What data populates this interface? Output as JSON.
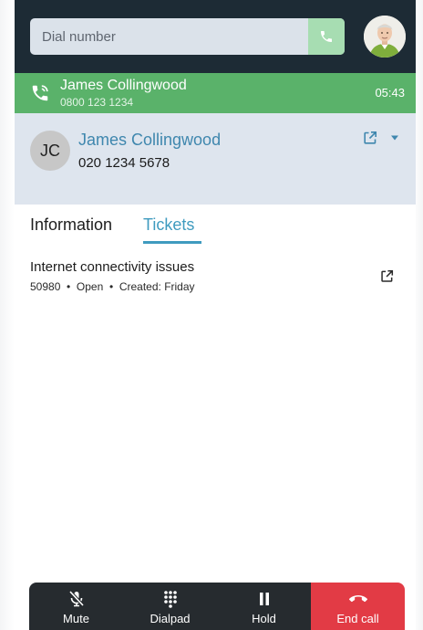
{
  "dial": {
    "placeholder": "Dial number",
    "call_icon": "phone-icon"
  },
  "active_call": {
    "name": "James Collingwood",
    "number": "0800 123 1234",
    "duration": "05:43",
    "icon": "phone-in-talk-icon"
  },
  "contact": {
    "initials": "JC",
    "name": "James Collingwood",
    "number": "020 1234 5678"
  },
  "tabs": [
    {
      "label": "Information",
      "active": false
    },
    {
      "label": "Tickets",
      "active": true
    }
  ],
  "tickets": [
    {
      "title": "Internet connectivity issues",
      "id": "50980",
      "status": "Open",
      "created": "Created: Friday",
      "separator": "•"
    }
  ],
  "actions": {
    "mute": "Mute",
    "dialpad": "Dialpad",
    "hold": "Hold",
    "end_call": "End call"
  },
  "colors": {
    "header": "#1d2b35",
    "call_green": "#5ab26a",
    "contact_bg": "#dee5ee",
    "link_blue": "#3f87ae",
    "tab_blue": "#3f9bbf",
    "end_red": "#e23b45",
    "action_dark": "#262b2f"
  }
}
